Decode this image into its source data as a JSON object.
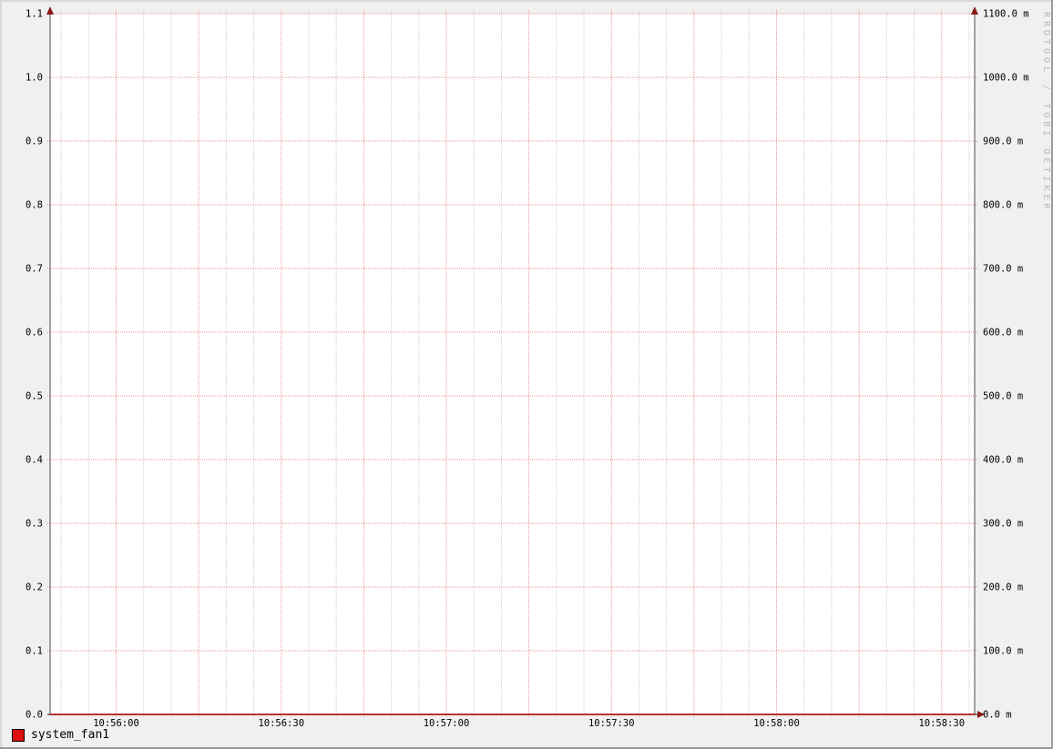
{
  "watermark": "RRDTOOL / TOBI OETIKER",
  "legend": {
    "items": [
      {
        "label": "system_fan1",
        "color": "#dd1010"
      }
    ]
  },
  "colors": {
    "background": "#f0f0f0",
    "plot_background": "#ffffff",
    "major_grid": "#e89494",
    "minor_grid": "#cdcdcd",
    "axis": "#4d4d4d",
    "arrow": "#8c1a1a",
    "series_line": "#c01010",
    "tick_text": "#000000",
    "watermark_text": "#b9b9b9",
    "bevel_light": "#d9d9d9",
    "bevel_dark": "#9b9b9b"
  },
  "chart_data": {
    "type": "line",
    "title": "",
    "xlabel": "",
    "ylabel": "",
    "grid": true,
    "legend_position": "bottom-left",
    "x_axis": {
      "unit": "time (HH:MM:SS)",
      "start_time": "10:55:48",
      "end_time": "10:58:36",
      "x_offsets_are_seconds_relative_to": "10:56:00",
      "range_offsets_s": [
        -12,
        156
      ],
      "minor_grid_interval_s": 5,
      "major_grid_interval_s": 15,
      "label_interval_s": 30,
      "tick_labels": [
        "10:56:00",
        "10:56:30",
        "10:57:00",
        "10:57:30",
        "10:58:00",
        "10:58:30"
      ]
    },
    "y_axis_left": {
      "min": 0.0,
      "max": 1.1,
      "step": 0.1,
      "tick_labels": [
        "0.0",
        "0.1",
        "0.2",
        "0.3",
        "0.4",
        "0.5",
        "0.6",
        "0.7",
        "0.8",
        "0.9",
        "1.0",
        "1.1"
      ]
    },
    "y_axis_right": {
      "min_label": "0.0 m",
      "max_label": "1100.0 m",
      "step": 100,
      "unit": "m",
      "tick_labels": [
        "0.0 m",
        "100.0 m",
        "200.0 m",
        "300.0 m",
        "400.0 m",
        "500.0 m",
        "600.0 m",
        "700.0 m",
        "800.0 m",
        "900.0 m",
        "1000.0 m",
        "1100.0 m"
      ]
    },
    "series": [
      {
        "name": "system_fan1",
        "color": "#dd1010",
        "points_t_v": [
          [
            -12,
            0.0
          ],
          [
            156,
            0.0
          ]
        ]
      }
    ]
  }
}
